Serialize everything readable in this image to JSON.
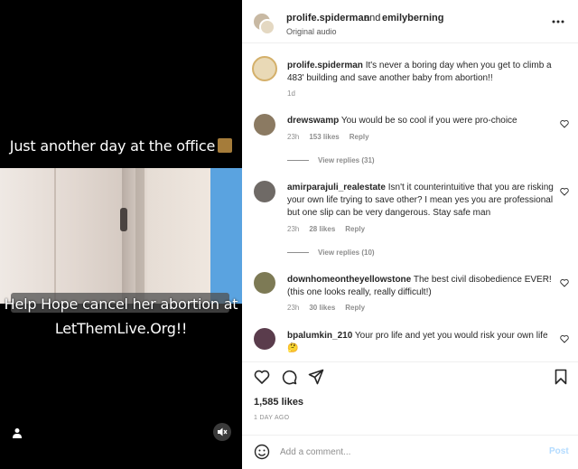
{
  "video": {
    "caption_top": "Just another day at the office",
    "caption_bottom_line1": "Help Hope cancel her abortion at",
    "caption_bottom_line2": "LetThemLive.Org!!"
  },
  "header": {
    "user1": "prolife.spiderman",
    "and": "and",
    "user2": "emilyberning",
    "audio": "Original audio"
  },
  "post": {
    "author": "prolife.spiderman",
    "text": "It's never a boring day when you get to climb a 483' building and save another baby from abortion!!",
    "time": "1d"
  },
  "comments": [
    {
      "user": "drewswamp",
      "text": "You would be so cool if you were pro-choice",
      "time": "23h",
      "likes": "153 likes",
      "reply": "Reply",
      "view_replies": "View replies (31)"
    },
    {
      "user": "amirparajuli_realestate",
      "text": "Isn't it counterintuitive that you are risking your own life trying to save other? I mean yes you are professional but one slip can be very dangerous. Stay safe man",
      "time": "23h",
      "likes": "28 likes",
      "reply": "Reply",
      "view_replies": "View replies (10)"
    },
    {
      "user": "downhomeontheyellowstone",
      "text": "The best civil disobedience EVER! (this one looks really, really difficult!)",
      "time": "23h",
      "likes": "30 likes",
      "reply": "Reply"
    },
    {
      "user": "bpalumkin_210",
      "text": "Your pro life and yet you would risk your own life",
      "emoji": "🤔"
    }
  ],
  "likes_count": "1,585 likes",
  "date": "1 DAY AGO",
  "comment_input": {
    "placeholder": "Add a comment...",
    "post_label": "Post"
  },
  "colors": {
    "post_button": "#b3dbff",
    "sky": "#5aa3e0",
    "muted": "#8e8e8e"
  }
}
